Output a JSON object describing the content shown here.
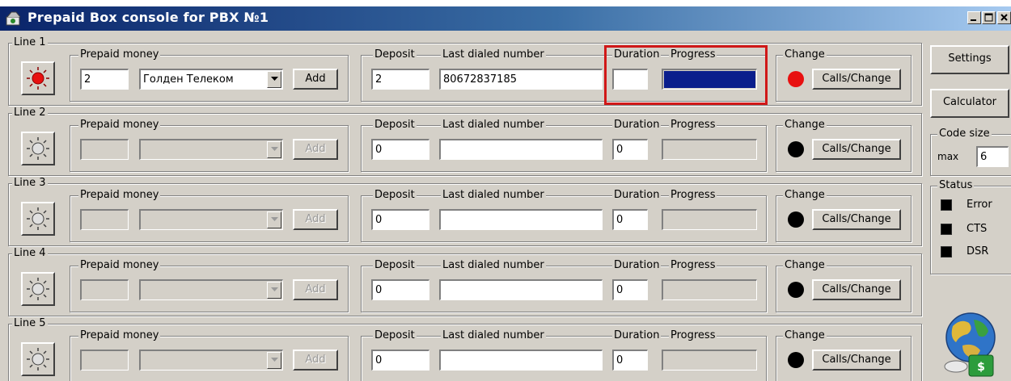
{
  "window": {
    "title": "Prepaid Box console for PBX  №1"
  },
  "colors": {
    "lamp_active": "#e81010",
    "lamp_idle": "#000000",
    "progress_fill": "#0a1e8c",
    "highlight": "#d01818"
  },
  "labels": {
    "prepaid_money": "Prepaid money",
    "deposit": "Deposit",
    "last_dialed_number": "Last dialed number",
    "duration": "Duration",
    "progress": "Progress",
    "change": "Change",
    "add": "Add",
    "calls_change": "Calls/Change"
  },
  "lines": [
    {
      "name": "Line 1",
      "prepaid_value": "2",
      "provider": "Голден Телеком",
      "deposit": "2",
      "last_dialed": "80672837185",
      "duration": "",
      "progress": 1.0,
      "active": true
    },
    {
      "name": "Line 2",
      "prepaid_value": "",
      "provider": "",
      "deposit": "0",
      "last_dialed": "",
      "duration": "0",
      "progress": 0,
      "active": false
    },
    {
      "name": "Line 3",
      "prepaid_value": "",
      "provider": "",
      "deposit": "0",
      "last_dialed": "",
      "duration": "0",
      "progress": 0,
      "active": false
    },
    {
      "name": "Line 4",
      "prepaid_value": "",
      "provider": "",
      "deposit": "0",
      "last_dialed": "",
      "duration": "0",
      "progress": 0,
      "active": false
    },
    {
      "name": "Line 5",
      "prepaid_value": "",
      "provider": "",
      "deposit": "0",
      "last_dialed": "",
      "duration": "0",
      "progress": 0,
      "active": false
    }
  ],
  "sidebar": {
    "settings_label": "Settings",
    "calculator_label": "Calculator",
    "code_size": {
      "title": "Code size",
      "max_label": "max",
      "value": "6"
    },
    "status": {
      "title": "Status",
      "items": [
        "Error",
        "CTS",
        "DSR"
      ]
    }
  },
  "icons": {
    "app": "phone-app-icon",
    "lamp": "lamp-icon",
    "globe": "globe-money-icon"
  }
}
